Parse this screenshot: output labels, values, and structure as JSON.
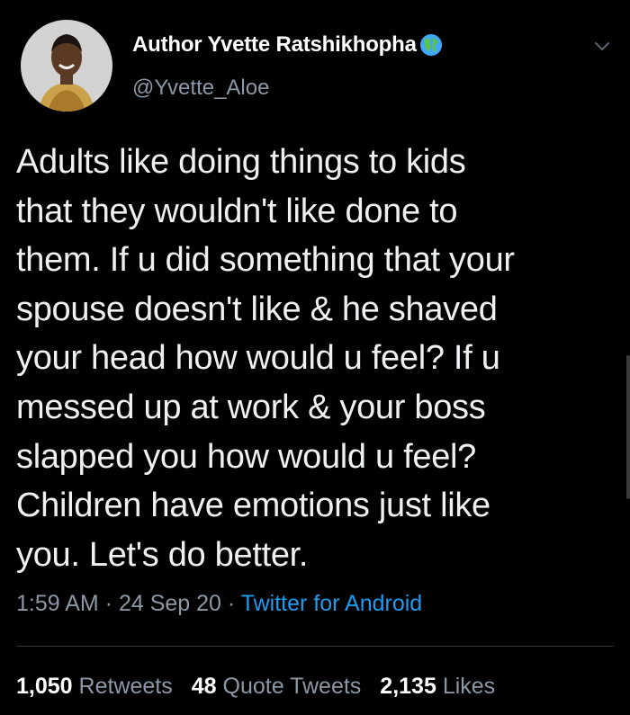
{
  "author": {
    "display_name": "Author Yvette Ratshikhopha",
    "handle": "@Yvette_Aloe",
    "avatar_icon": "profile-photo",
    "badge_icon": "globe-icon"
  },
  "tweet": {
    "text": "Adults like doing things to kids\nthat they wouldn't like done to\nthem. If u did something that your\nspouse doesn't like & he shaved\nyour head how would u feel? If u\nmessed up at work & your boss\nslapped you how would u feel?\nChildren have emotions just like\nyou. Let's do better.",
    "time": "1:59 AM",
    "date": "24 Sep 20",
    "source": "Twitter for Android",
    "separator": " · "
  },
  "stats": {
    "retweets_count": "1,050",
    "retweets_label": "Retweets",
    "quotes_count": "48",
    "quotes_label": "Quote Tweets",
    "likes_count": "2,135",
    "likes_label": "Likes"
  },
  "colors": {
    "background": "#000000",
    "text": "#eef0f1",
    "secondary": "#8b98a5",
    "accent": "#1d9bf0"
  }
}
